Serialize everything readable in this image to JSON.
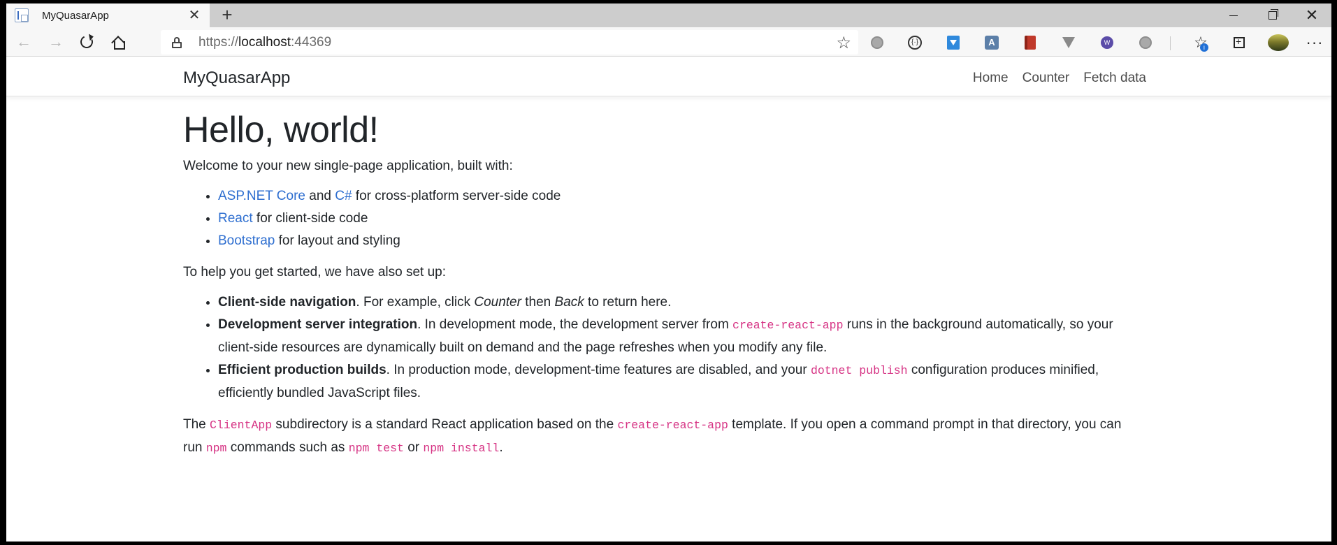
{
  "browser": {
    "tab_title": "MyQuasarApp",
    "tab_close": "✕",
    "new_tab": "+",
    "url_scheme": "https://",
    "url_host": "localhost",
    "url_port": ":44369",
    "extensions": [
      "gray-extension",
      "code-extension",
      "download-extension",
      "translate-extension",
      "book-extension",
      "vue-extension",
      "purple-extension",
      "gray-extension-2"
    ],
    "favorites_badge": "i",
    "more": "···"
  },
  "navbar": {
    "brand": "MyQuasarApp",
    "links": [
      "Home",
      "Counter",
      "Fetch data"
    ]
  },
  "content": {
    "heading": "Hello, world!",
    "intro": "Welcome to your new single-page application, built with:",
    "built_with": {
      "item1_link1": "ASP.NET Core",
      "item1_and": " and ",
      "item1_link2": "C#",
      "item1_rest": " for cross-platform server-side code",
      "item2_link": "React",
      "item2_rest": " for client-side code",
      "item3_link": "Bootstrap",
      "item3_rest": " for layout and styling"
    },
    "setup_intro": "To help you get started, we have also set up:",
    "features": {
      "f1_title": "Client-side navigation",
      "f1_a": ". For example, click ",
      "f1_counter": "Counter",
      "f1_b": " then ",
      "f1_back": "Back",
      "f1_c": " to return here.",
      "f2_title": "Development server integration",
      "f2_a": ". In development mode, the development server from ",
      "f2_code": "create-react-app",
      "f2_b": " runs in the background automatically, so your client-side resources are dynamically built on demand and the page refreshes when you modify any file.",
      "f3_title": "Efficient production builds",
      "f3_a": ". In production mode, development-time features are disabled, and your ",
      "f3_code": "dotnet publish",
      "f3_b": " configuration produces minified, efficiently bundled JavaScript files."
    },
    "final": {
      "a": "The ",
      "code1": "ClientApp",
      "b": " subdirectory is a standard React application based on the ",
      "code2": "create-react-app",
      "c": " template. If you open a command prompt in that directory, you can run ",
      "code3": "npm",
      "d": " commands such as ",
      "code4": "npm test",
      "e": " or ",
      "code5": "npm install",
      "f": "."
    }
  }
}
